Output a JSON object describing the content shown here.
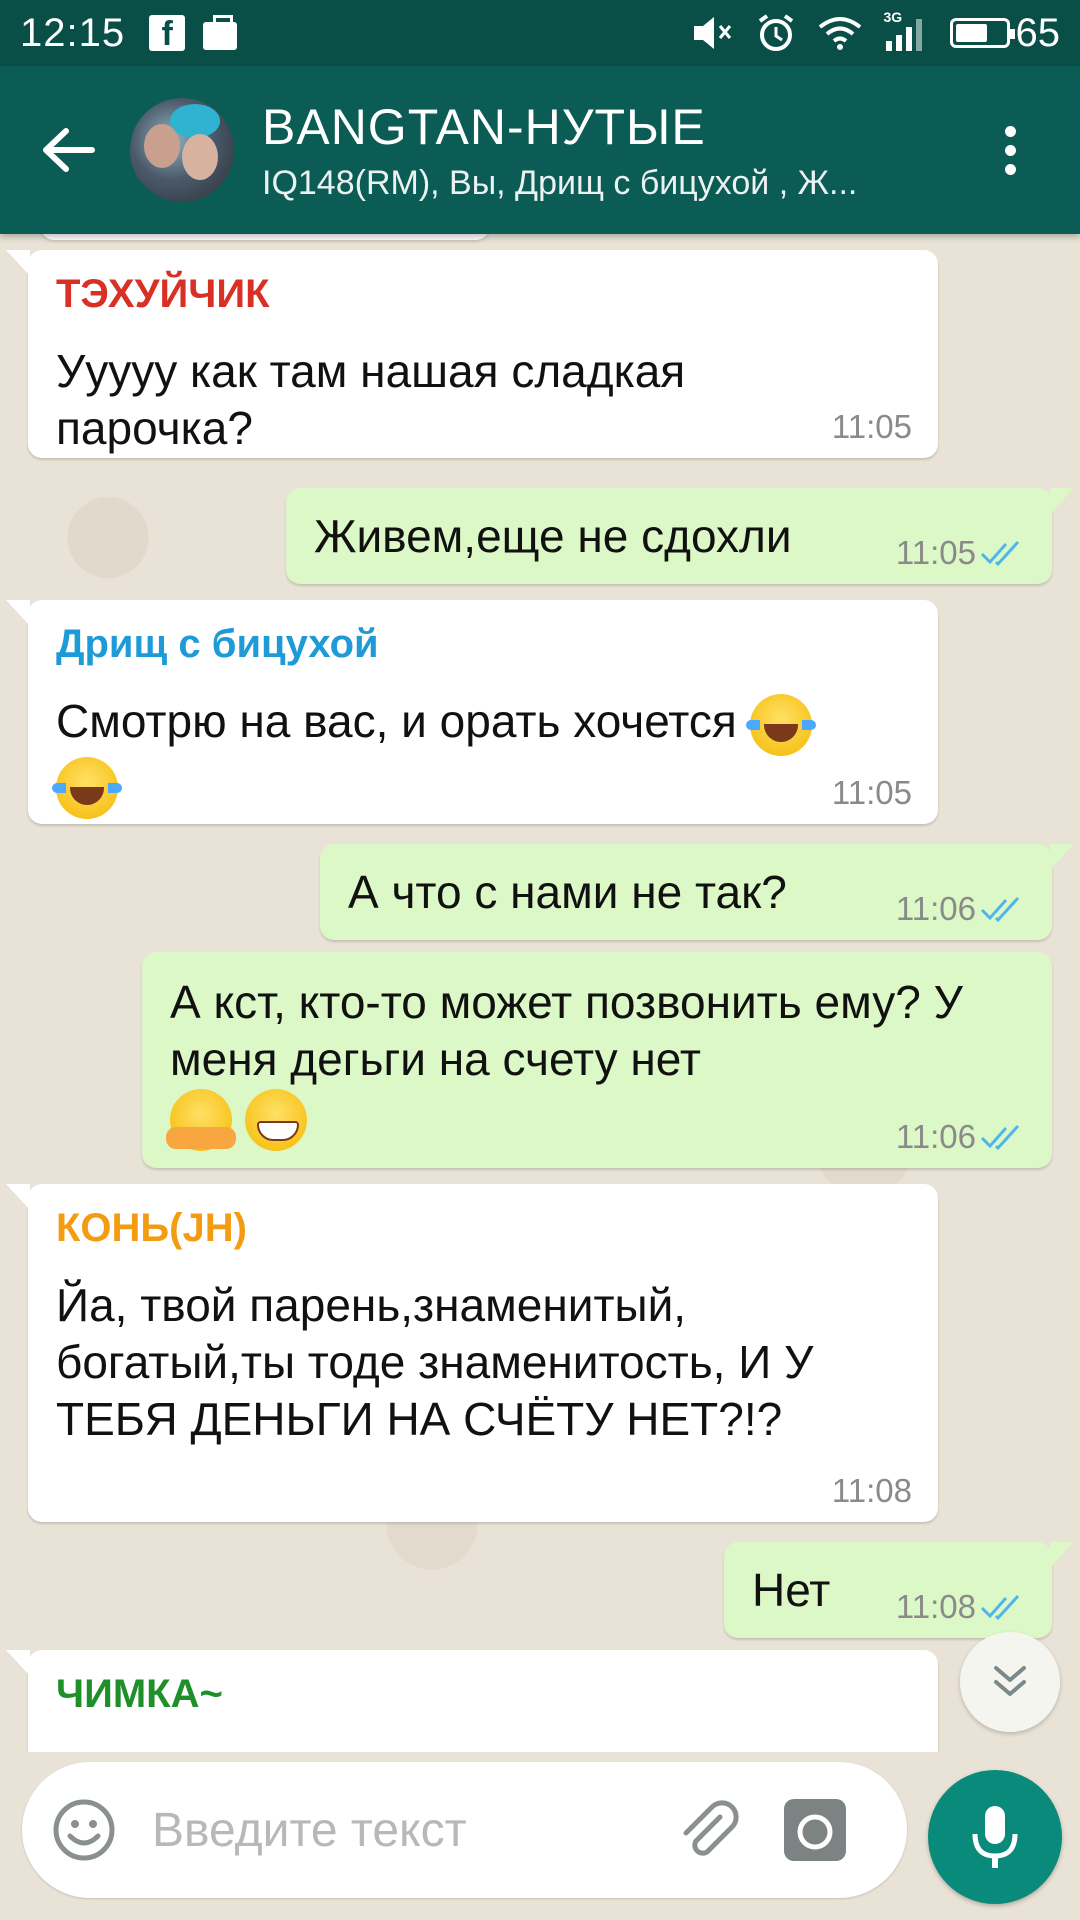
{
  "status_bar": {
    "time": "12:15",
    "battery": "65",
    "battery_level_percent": 65,
    "network_label": "3G"
  },
  "header": {
    "title": "BANGTAN-НУТЫЕ",
    "subtitle": "IQ148(RM), Вы, Дрищ с бицухой , Ж..."
  },
  "messages": [
    {
      "direction": "in",
      "sender": "ТЭХУЙЧИК",
      "sender_color": "#d93025",
      "text": "Ууууу как там нашая сладкая парочка?",
      "time": "11:05"
    },
    {
      "direction": "out",
      "text": "Живем,еще не сдохли",
      "time": "11:05",
      "status": "read"
    },
    {
      "direction": "in",
      "sender": "Дрищ с бицухой",
      "sender_color": "#1e9bd7",
      "text": "Смотрю на вас, и орать хочется",
      "emoji": [
        "face-with-tears-of-joy",
        "face-with-tears-of-joy"
      ],
      "time": "11:05"
    },
    {
      "direction": "out",
      "text": "А что с нами не так?",
      "time": "11:06",
      "status": "read"
    },
    {
      "direction": "out",
      "text": "А кст, кто-то может позвонить ему? У меня дегьги на счету нет",
      "emoji": [
        "hugging-face",
        "grinning-face"
      ],
      "time": "11:06",
      "status": "read"
    },
    {
      "direction": "in",
      "sender": "КОНЬ(JH)",
      "sender_color": "#f39c12",
      "text": "Йа, твой парень,знаменитый, богатый,ты тоде знаменитость, И У ТЕБЯ ДЕНЬГИ НА СЧЁТУ НЕТ?!?",
      "time": "11:08"
    },
    {
      "direction": "out",
      "text": "Нет",
      "time": "11:08",
      "status": "read"
    },
    {
      "direction": "in",
      "sender": "ЧИМКА~",
      "sender_color": "#1f8f2a",
      "text": "",
      "time": ""
    }
  ],
  "composer": {
    "placeholder": "Введите текст"
  },
  "icons": {
    "back": "arrow-back-icon",
    "menu": "more-vert-icon",
    "emoji": "smiley-icon",
    "attach": "paperclip-icon",
    "camera": "camera-icon",
    "mic": "microphone-icon",
    "scroll": "double-chevron-down-icon",
    "read_receipt": "double-check-icon"
  },
  "colors": {
    "header": "#0a5c54",
    "status_bar": "#0a4f47",
    "outgoing_bubble": "#dcf8c6",
    "incoming_bubble": "#ffffff",
    "read_tick": "#4fb6ec",
    "mic_button": "#0a8a7a"
  }
}
